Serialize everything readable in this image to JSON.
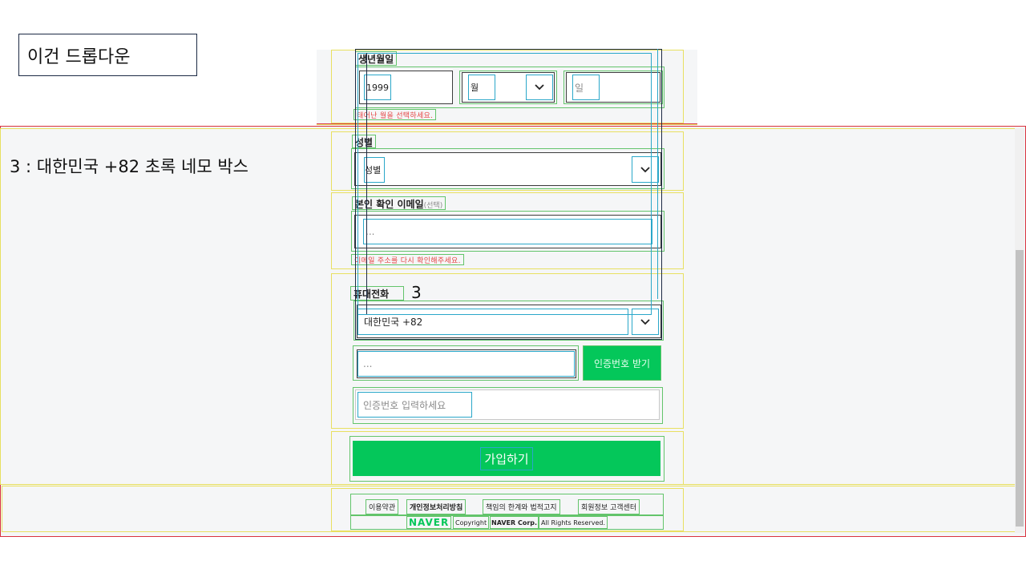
{
  "annotations": {
    "dropdown_note": "이건 드롭다운",
    "green_box_note": "3 : 대한민국 +82 초록 네모 박스",
    "marker": "3"
  },
  "form": {
    "birth": {
      "label": "생년월일",
      "year_value": "1999",
      "month_placeholder": "월",
      "day_placeholder": "일",
      "error": "태어난 월을 선택하세요."
    },
    "gender": {
      "label": "성별",
      "placeholder": "성별"
    },
    "email": {
      "label": "본인 확인 이메일",
      "label_optional": "(선택)",
      "placeholder": "...",
      "error": "이메일 주소를 다시 확인해주세요."
    },
    "phone": {
      "label": "휴대전화",
      "country": "대한민국 +82",
      "number_placeholder": "...",
      "send_code_button": "인증번호 받기",
      "code_placeholder": "인증번호 입력하세요"
    },
    "submit_button": "가입하기"
  },
  "footer": {
    "links": [
      "이용약관",
      "개인정보처리방침",
      "책임의 한계와 법적고지",
      "회원정보 고객센터"
    ],
    "brand": "NAVER",
    "copyright": "Copyright",
    "corp": "NAVER Corp.",
    "rights": "All Rights Reserved."
  },
  "colors": {
    "accent_green": "#04c75a",
    "error_red": "#e64545",
    "guide_yellow": "#e8e060",
    "guide_green": "#63c46b",
    "guide_teal": "#2aa7c9"
  }
}
